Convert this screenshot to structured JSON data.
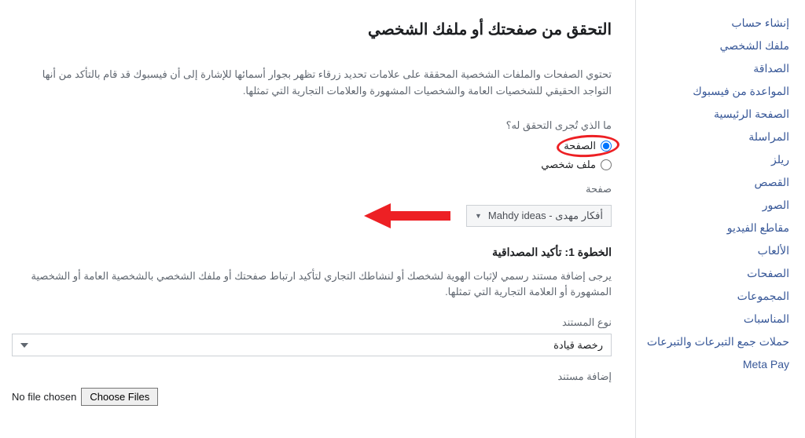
{
  "sidebar": {
    "items": [
      {
        "label": "إنشاء حساب"
      },
      {
        "label": "ملفك الشخصي"
      },
      {
        "label": "الصداقة"
      },
      {
        "label": "المواعدة من فيسبوك"
      },
      {
        "label": "الصفحة الرئيسية"
      },
      {
        "label": "المراسلة"
      },
      {
        "label": "ريلز"
      },
      {
        "label": "القصص"
      },
      {
        "label": "الصور"
      },
      {
        "label": "مقاطع الفيديو"
      },
      {
        "label": "الألعاب"
      },
      {
        "label": "الصفحات"
      },
      {
        "label": "المجموعات"
      },
      {
        "label": "المناسبات"
      },
      {
        "label": "حملات جمع التبرعات والتبرعات"
      },
      {
        "label": "Meta Pay"
      }
    ]
  },
  "main": {
    "title": "التحقق من صفحتك أو ملفك الشخصي",
    "intro": "تحتوي الصفحات والملفات الشخصية المحققة على علامات تحديد زرقاء تظهر بجوار أسمائها للإشارة إلى أن فيسبوك قد قام بالتأكد من أنها التواجد الحقيقي للشخصيات العامة والشخصيات المشهورة والعلامات التجارية التي تمثلها.",
    "question": "ما الذي تُجرى التحقق له؟",
    "radio_page": "الصفحة",
    "radio_profile": "ملف شخصي",
    "page_label": "صفحة",
    "selected_page": "Mahdy ideas - أفكار مهدى",
    "step_title": "الخطوة 1: تأكيد المصداقية",
    "step_desc": "يرجى إضافة مستند رسمي لإثبات الهوية لشخصك أو لنشاطك التجاري لتأكيد ارتباط صفحتك أو ملفك الشخصي بالشخصية العامة أو الشخصية المشهورة أو العلامة التجارية التي تمثلها.",
    "doc_type_label": "نوع المستند",
    "doc_type_value": "رخصة قيادة",
    "add_doc_label": "إضافة مستند",
    "choose_files": "Choose Files",
    "no_file": "No file chosen"
  }
}
